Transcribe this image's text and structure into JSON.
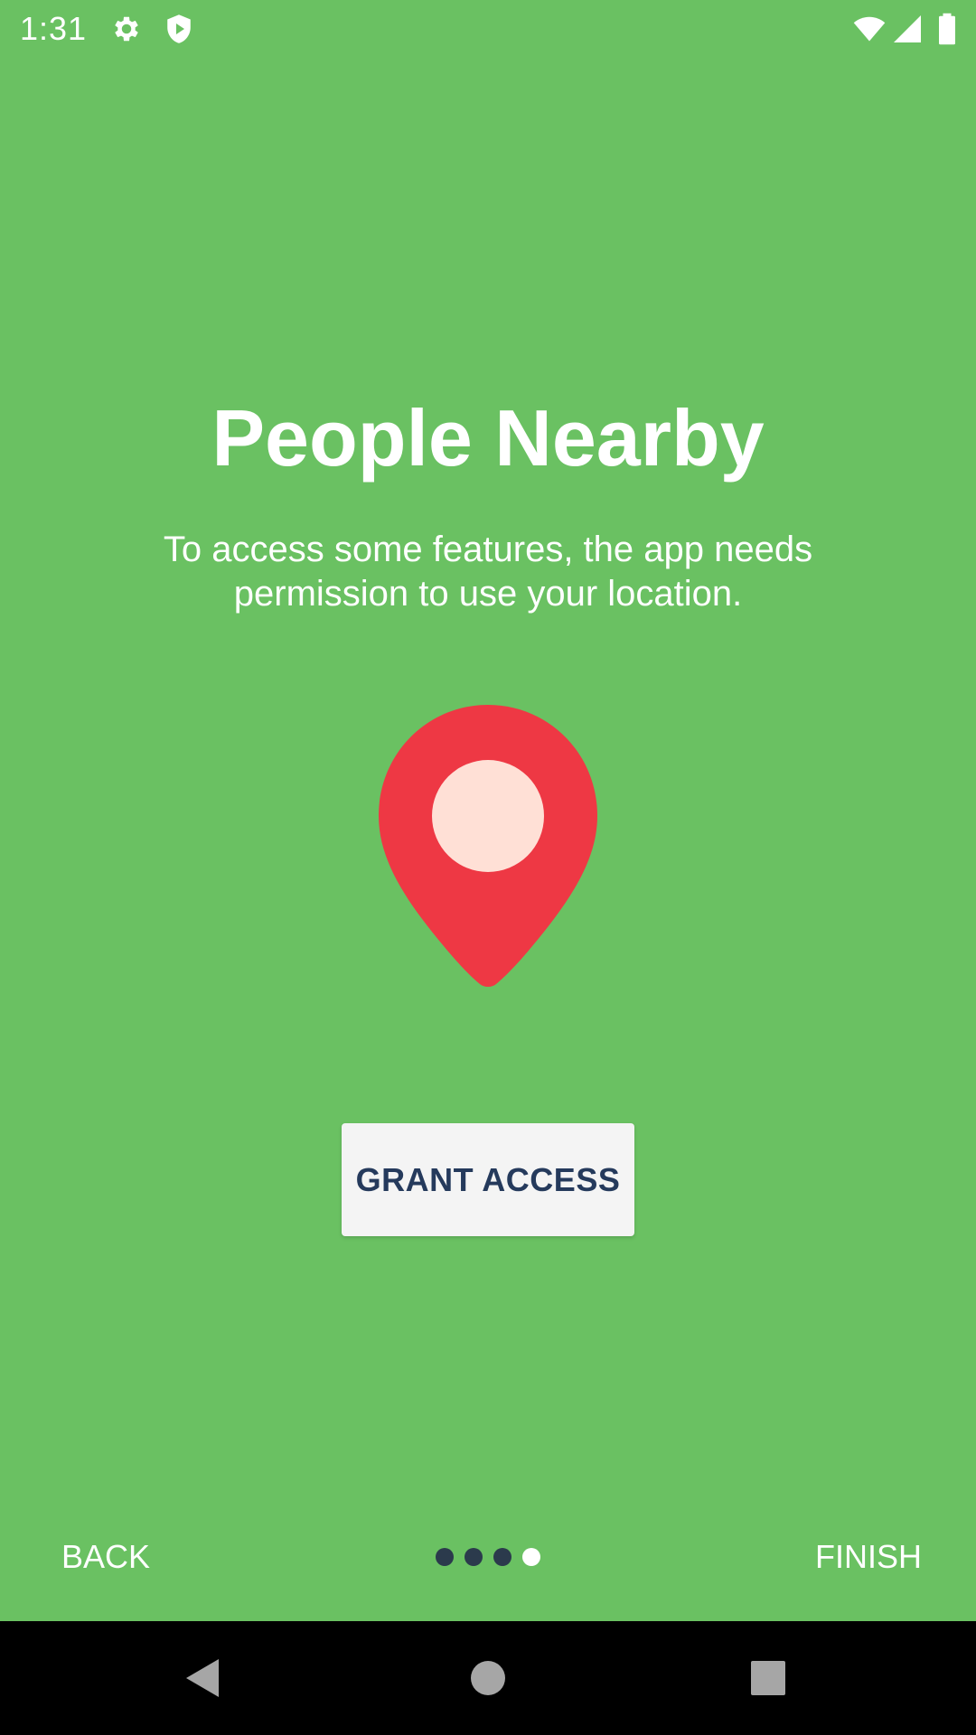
{
  "status_bar": {
    "time": "1:31",
    "icons_left": [
      "gear-icon",
      "shield-icon"
    ],
    "icons_right": [
      "wifi-icon",
      "cell-signal-icon",
      "battery-icon"
    ]
  },
  "onboarding": {
    "title": "People Nearby",
    "description": "To access some features, the app needs permission to use your location.",
    "illustration": "location-pin-icon",
    "grant_button_label": "GRANT ACCESS"
  },
  "footer": {
    "back_label": "BACK",
    "finish_label": "FINISH",
    "page_count": 4,
    "current_page": 4
  },
  "nav_bar": {
    "buttons": [
      "back-triangle-icon",
      "home-circle-icon",
      "recents-square-icon"
    ]
  },
  "colors": {
    "background": "#6AC162",
    "pin": "#EE3844",
    "pin_center": "#FFE0D6",
    "button_text": "#253A5C",
    "button_bg": "#F4F4F4",
    "dot_inactive": "#2B3A4C",
    "dot_active": "#FFFFFF"
  }
}
